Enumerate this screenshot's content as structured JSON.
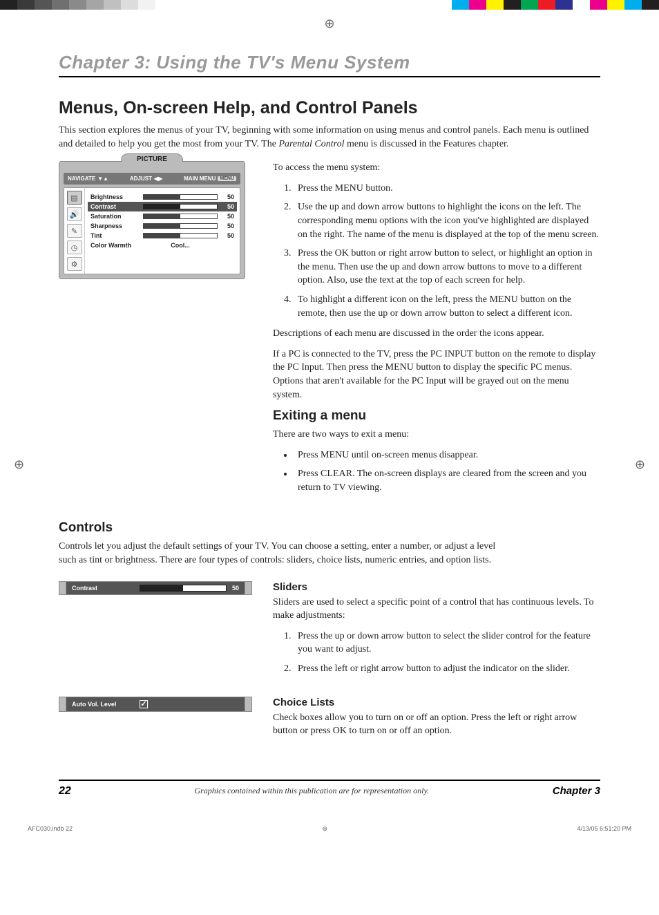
{
  "chapter_title": "Chapter 3: Using the TV's Menu System",
  "h2_menus": "Menus, On-screen Help, and Control Panels",
  "intro_1": "This section explores the menus of your TV, beginning with some information on using menus and control panels. Each menu is outlined and detailed to help you get the most from your TV. The ",
  "intro_ital": "Parental Control",
  "intro_2": " menu is discussed in the Features chapter.",
  "tv_menu": {
    "tab": "PICTURE",
    "nav_left": "NAVIGATE",
    "nav_mid": "ADJUST",
    "nav_right": "MAIN MENU",
    "nav_btn": "MENU",
    "rows": [
      {
        "label": "Brightness",
        "value": "50",
        "selected": false
      },
      {
        "label": "Contrast",
        "value": "50",
        "selected": true
      },
      {
        "label": "Saturation",
        "value": "50",
        "selected": false
      },
      {
        "label": "Sharpness",
        "value": "50",
        "selected": false
      },
      {
        "label": "Tint",
        "value": "50",
        "selected": false
      }
    ],
    "color_warmth_label": "Color Warmth",
    "color_warmth_value": "Cool..."
  },
  "access_intro": "To access the menu system:",
  "step1": "Press the MENU button.",
  "step2": "Use the up and down arrow buttons to highlight the icons on the left. The corresponding menu options with the icon you've highlighted are displayed on the right. The name of the menu is displayed at the top of the menu screen.",
  "step3": "Press the OK button or right arrow button to select, or highlight an option in the menu. Then use the up and down arrow buttons to move to a different option. Also, use the text at the top of each screen for help.",
  "step4": "To highlight a different icon on the left, press the MENU button on the remote, then use the up or down arrow button to select a different icon.",
  "desc_p": "Descriptions of each menu are discussed in the order the icons appear.",
  "pc_p": "If a PC is connected to the TV, press the PC INPUT button on the remote to display the PC Input. Then press the MENU button to display the specific PC menus. Options that aren't available for the PC Input will be grayed out on the menu system.",
  "h3_exit": "Exiting a menu",
  "exit_intro": "There are two ways to exit a menu:",
  "exit_b1": "Press MENU until on-screen menus disappear.",
  "exit_b2": "Press CLEAR. The on-screen displays are cleared from the screen and you return to TV viewing.",
  "h3_controls": "Controls",
  "controls_intro": "Controls let you adjust the default settings of your TV. You can choose a setting, enter a number, or adjust a level such as tint or brightness. There are four types of controls: sliders, choice lists, numeric entries, and option lists.",
  "slider_bar": {
    "label": "Contrast",
    "value": "50"
  },
  "h4_sliders": "Sliders",
  "sliders_intro": "Sliders are used to select a specific point of a control that has continuous levels. To make adjustments:",
  "slider_s1": "Press the up or down arrow button to select the slider control for the feature you want to adjust.",
  "slider_s2": "Press the left or right arrow button to adjust the indicator on the slider.",
  "choice_bar": {
    "label": "Auto Vol. Level"
  },
  "h4_choice": "Choice Lists",
  "choice_intro": "Check boxes allow you to turn on or off an option. Press the left or right arrow button or press OK to turn on or off an option.",
  "footer": {
    "page": "22",
    "note": "Graphics contained within this publication are for representation only.",
    "chapter": "Chapter 3"
  },
  "print": {
    "left": "AFC030.indb   22",
    "right": "4/13/05   6:51:20 PM"
  },
  "colorbar_left": [
    "#222",
    "#3a3a3a",
    "#555",
    "#707070",
    "#8a8a8a",
    "#a5a5a5",
    "#c0c0c0",
    "#dcdcdc",
    "#f2f2f2"
  ],
  "colorbar_right": [
    "#00aeef",
    "#ec008c",
    "#fff200",
    "#231f20",
    "#00a651",
    "#ed1c24",
    "#2e3192",
    "#fff",
    "#ec008c",
    "#fff200",
    "#00aeef",
    "#231f20"
  ]
}
